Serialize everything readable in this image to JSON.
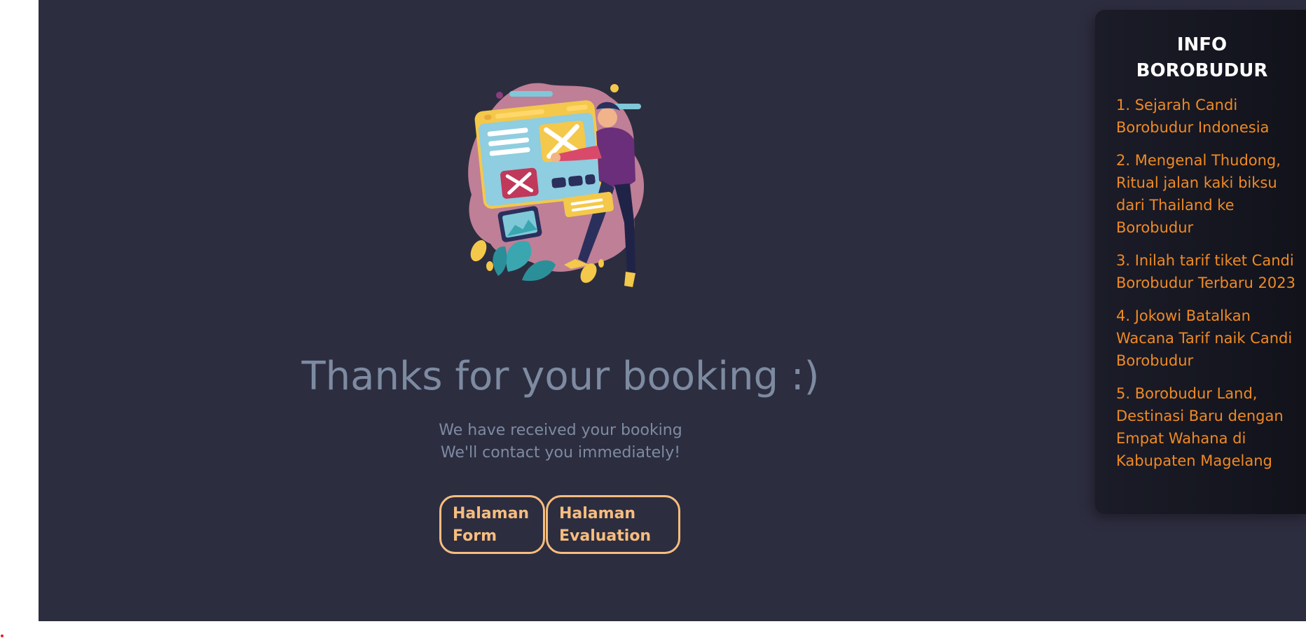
{
  "main": {
    "title": "Thanks for your booking :)",
    "subtitle_line1": "We have received your booking",
    "subtitle_line2": "We'll contact you immediately!",
    "buttons": [
      {
        "label": "Halaman Form"
      },
      {
        "label": "Halaman Evaluation"
      }
    ],
    "illustration_icon": "booking-rejected-illustration"
  },
  "sidebar": {
    "title": "INFO BOROBUDUR",
    "items": [
      {
        "label": "1. Sejarah Candi Borobudur Indonesia"
      },
      {
        "label": "2. Mengenal Thudong, Ritual jalan kaki biksu dari Thailand ke Borobudur"
      },
      {
        "label": "3. Inilah tarif tiket Candi Borobudur Terbaru 2023"
      },
      {
        "label": "4. Jokowi Batalkan Wacana Tarif naik Candi Borobudur"
      },
      {
        "label": "5. Borobudur Land, Destinasi Baru dengan Empat Wahana di Kabupaten Magelang"
      }
    ]
  },
  "colors": {
    "background": "#2d2d40",
    "text_muted": "#7d8ba1",
    "button_accent": "#f7bd7e",
    "link_orange": "#f08a24",
    "panel_dark": "#15161f"
  }
}
